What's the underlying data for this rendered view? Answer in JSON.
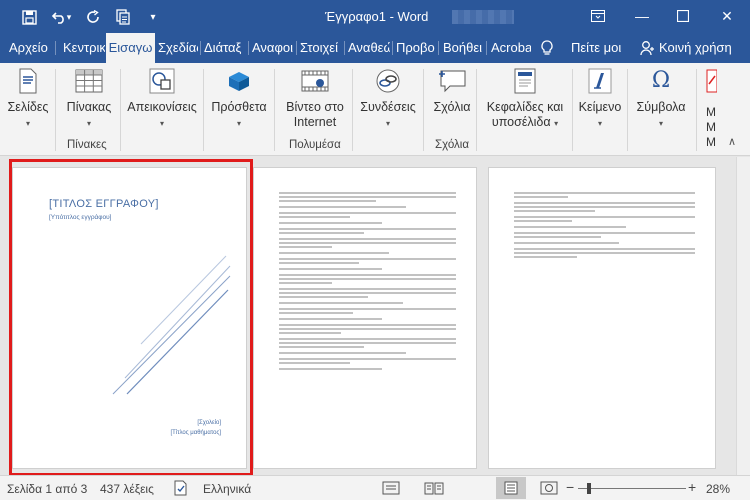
{
  "window": {
    "title": "Έγγραφο1 - Word",
    "buttons": {
      "ribbon_options": "□",
      "minimize": "—",
      "maximize": "☐",
      "close": "✕"
    }
  },
  "quick_access": {
    "save_icon": "save-icon",
    "undo_icon": "undo-icon",
    "redo_icon": "redo-icon",
    "touch_icon": "touch-mode-icon",
    "customize": "▾"
  },
  "tabs": [
    {
      "label": "Αρχείο"
    },
    {
      "label": "Κεντρικ"
    },
    {
      "label": "Εισαγω"
    },
    {
      "label": "Σχεδίας"
    },
    {
      "label": "Διάταξ"
    },
    {
      "label": "Αναφοι"
    },
    {
      "label": "Στοιχεί"
    },
    {
      "label": "Αναθεώ"
    },
    {
      "label": "Προβο"
    },
    {
      "label": "Βοήθει"
    },
    {
      "label": "Acroba"
    }
  ],
  "tell_me": "Πείτε μοι",
  "share": "Κοινή χρήση",
  "ribbon": {
    "pages": {
      "label": "Σελίδες"
    },
    "table": {
      "label": "Πίνακας",
      "group": "Πίνακες"
    },
    "illustrations": {
      "label": "Απεικονίσεις"
    },
    "addins": {
      "label": "Πρόσθετα"
    },
    "video": {
      "label_1": "Βίντεο στο",
      "label_2": "Internet",
      "group": "Πολυμέσα"
    },
    "links": {
      "label": "Συνδέσεις"
    },
    "comment": {
      "label": "Σχόλια",
      "group": "Σχόλια"
    },
    "header_footer": {
      "label_1": "Κεφαλίδες και",
      "label_2": "υποσέλιδα"
    },
    "text": {
      "label": "Κείμενο"
    },
    "symbols": {
      "label": "Σύμβολα"
    }
  },
  "document": {
    "cover_title": "[ΤΙΤΛΟΣ ΕΓΓΡΑΦΟΥ]",
    "cover_subtitle": "[Υπότιτλος εγγράφου]",
    "cover_school": "[Σχολείο]",
    "cover_course": "[Τίτλος μαθήματος]"
  },
  "status": {
    "page": "Σελίδα 1 από 3",
    "words": "437 λέξεις",
    "language": "Ελληνικά",
    "zoom": "28%",
    "zoom_fraction": 0.28
  },
  "colors": {
    "accent": "#2b579a",
    "selection": "#e01b1b"
  }
}
